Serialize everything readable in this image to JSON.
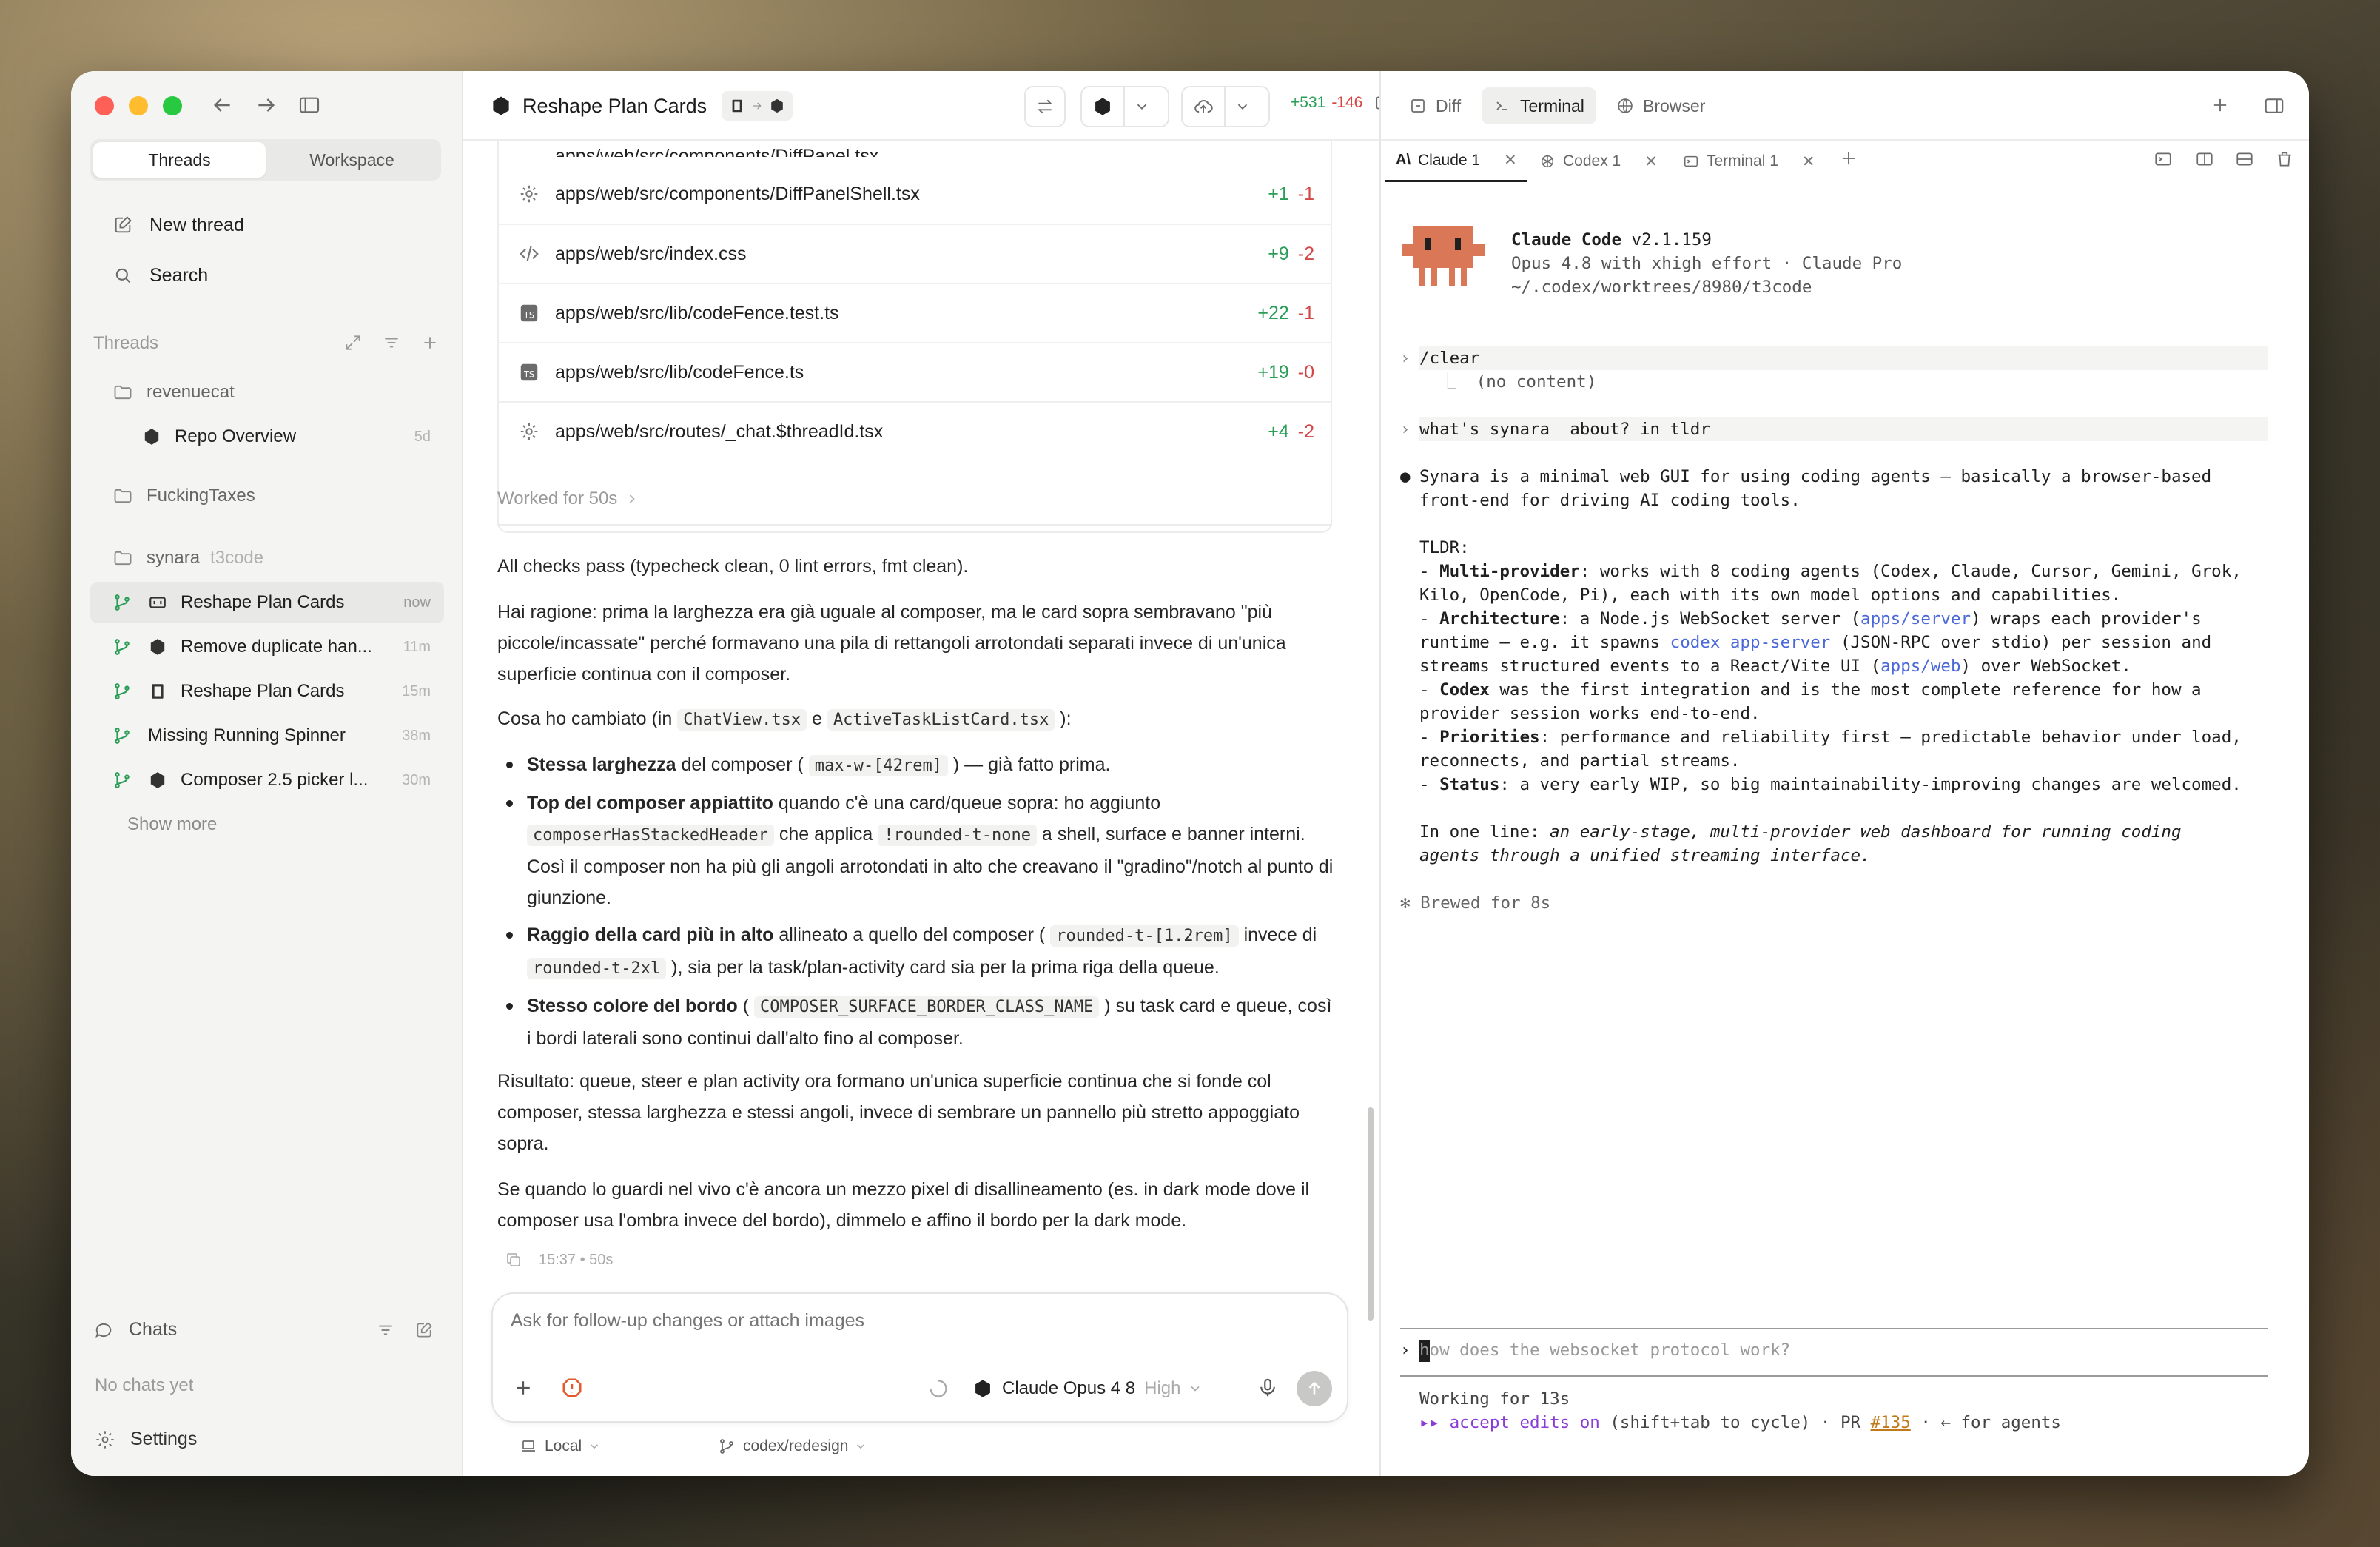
{
  "window": {
    "title": "Reshape Plan Cards",
    "diff_add": "+531",
    "diff_del": "-146"
  },
  "sidebar": {
    "tabs": [
      "Threads",
      "Workspace"
    ],
    "new_thread": "New thread",
    "search": "Search",
    "threads_header": "Threads",
    "projects": [
      {
        "name": "revenuecat",
        "items": [
          {
            "title": "Repo Overview",
            "time": "5d"
          }
        ]
      },
      {
        "name": "FuckingTaxes",
        "items": []
      },
      {
        "name": "synara",
        "tag": "t3code",
        "items": [
          {
            "title": "Reshape Plan Cards",
            "time": "now"
          },
          {
            "title": "Remove duplicate han...",
            "time": "11m"
          },
          {
            "title": "Reshape Plan Cards",
            "time": "15m"
          },
          {
            "title": "Missing Running Spinner",
            "time": "38m"
          },
          {
            "title": "Composer 2.5 picker l...",
            "time": "30m"
          }
        ]
      }
    ],
    "show_more": "Show more",
    "chats": "Chats",
    "no_chats": "No chats yet",
    "settings": "Settings"
  },
  "center": {
    "partial_file": "apps/web/src/components/DiffPanel.tsx",
    "files": [
      {
        "name": "apps/web/src/components/DiffPanelShell.tsx",
        "add": "+1",
        "del": "-1"
      },
      {
        "name": "apps/web/src/index.css",
        "add": "+9",
        "del": "-2"
      },
      {
        "name": "apps/web/src/lib/codeFence.test.ts",
        "add": "+22",
        "del": "-1"
      },
      {
        "name": "apps/web/src/lib/codeFence.ts",
        "add": "+19",
        "del": "-0"
      },
      {
        "name": "apps/web/src/routes/_chat.$threadId.tsx",
        "add": "+4",
        "del": "-2"
      }
    ],
    "worked": "Worked for 50s",
    "p1": "All checks pass (typecheck clean, 0 lint errors, fmt clean).",
    "p2": "Hai ragione: prima la larghezza era già uguale al composer, ma le card sopra sembravano \"più piccole/incassate\" perché formavano una pila di rettangoli arrotondati separati invece di un'unica superficie continua con il composer.",
    "p3a": "Cosa ho cambiato (in ",
    "p3c1": "ChatView.tsx",
    "p3b": " e ",
    "p3c2": "ActiveTaskListCard.tsx",
    "p3d": " ):",
    "b1": {
      "strong": "Stessa larghezza",
      "t1": " del composer ( ",
      "code": "max-w-[42rem]",
      "t2": " ) — già fatto prima."
    },
    "b2": {
      "strong": "Top del composer appiattito",
      "t1": " quando c'è una card/queue sopra: ho aggiunto ",
      "code1": "composerHasStackedHeader",
      "t2": " che applica ",
      "code2": "!rounded-t-none",
      "t3": " a shell, surface e banner interni. Così il composer non ha più gli angoli arrotondati in alto che creavano il \"gradino\"/notch al punto di giunzione."
    },
    "b3": {
      "strong": "Raggio della card più in alto",
      "t1": " allineato a quello del composer ( ",
      "code1": "rounded-t-[1.2rem]",
      "t2": " invece di ",
      "code2": "rounded-t-2xl",
      "t3": " ), sia per la task/plan-activity card sia per la prima riga della queue."
    },
    "b4": {
      "strong": "Stesso colore del bordo",
      "t1": " ( ",
      "code": "COMPOSER_SURFACE_BORDER_CLASS_NAME",
      "t2": " ) su task card e queue, così i bordi laterali sono continui dall'alto fino al composer."
    },
    "p4": "Risultato: queue, steer e plan activity ora formano un'unica superficie continua che si fonde col composer, stessa larghezza e stessi angoli, invece di sembrare un pannello più stretto appoggiato sopra.",
    "p5": "Se quando lo guardi nel vivo c'è ancora un mezzo pixel di disallineamento (es. in dark mode dove il composer usa l'ombra invece del bordo), dimmelo e affino il bordo per la dark mode.",
    "meta": "15:37 • 50s",
    "composer": {
      "placeholder": "Ask for follow-up changes or attach images",
      "model": "Claude Opus 4 8",
      "effort": "High"
    },
    "footer": {
      "env": "Local",
      "branch": "codex/redesign"
    }
  },
  "right": {
    "tabs": [
      "Diff",
      "Terminal",
      "Browser"
    ],
    "term_tabs": [
      "Claude 1",
      "Codex 1",
      "Terminal 1"
    ],
    "header": {
      "name": "Claude Code",
      "version": " v2.1.159",
      "line2": "Opus 4.8 with xhigh effort · Claude Pro",
      "line3": "~/.codex/worktrees/8980/t3code"
    },
    "cmd1": "/clear",
    "cmd1_out": "(no content)",
    "cmd2": "what's synara  about? in tldr",
    "ans1": "Synara is a minimal web GUI for using coding agents — basically a browser-based\nfront-end for driving AI coding tools.",
    "tldr": "TLDR:",
    "l1b": "Multi-provider",
    "l1": ": works with 8 coding agents (Codex, Claude, Cursor, Gemini, Grok,\nKilo, OpenCode, Pi), each with its own model options and capabilities.",
    "l2b": "Architecture",
    "l2a": ": a Node.js WebSocket server (",
    "l2l1": "apps/server",
    "l2c": ") wraps each provider's\nruntime — e.g. it spawns ",
    "l2l2": "codex app-server",
    "l2d": " (JSON-RPC over stdio) per session and\nstreams structured events to a React/Vite UI (",
    "l2l3": "apps/web",
    "l2e": ") over WebSocket.",
    "l3b": "Codex",
    "l3": " was the first integration and is the most complete reference for how a\nprovider session works end-to-end.",
    "l4b": "Priorities",
    "l4": ": performance and reliability first — predictable behavior under load,\nreconnects, and partial streams.",
    "l5b": "Status",
    "l5": ": a very early WIP, so big maintainability-improving changes are welcomed.",
    "oneline_a": "In one line: ",
    "oneline_i": "an early-stage, multi-provider web dashboard for running coding\nagents through a unified streaming interface.",
    "brewed": "✻ Brewed for 8s",
    "input": "how does the websocket protocol work?",
    "working": "Working for 13s",
    "status_a": "▸▸ accept edits on",
    "status_b": " (shift+tab to cycle) · PR ",
    "status_pr": "#135",
    "status_c": " · ← for agents"
  }
}
